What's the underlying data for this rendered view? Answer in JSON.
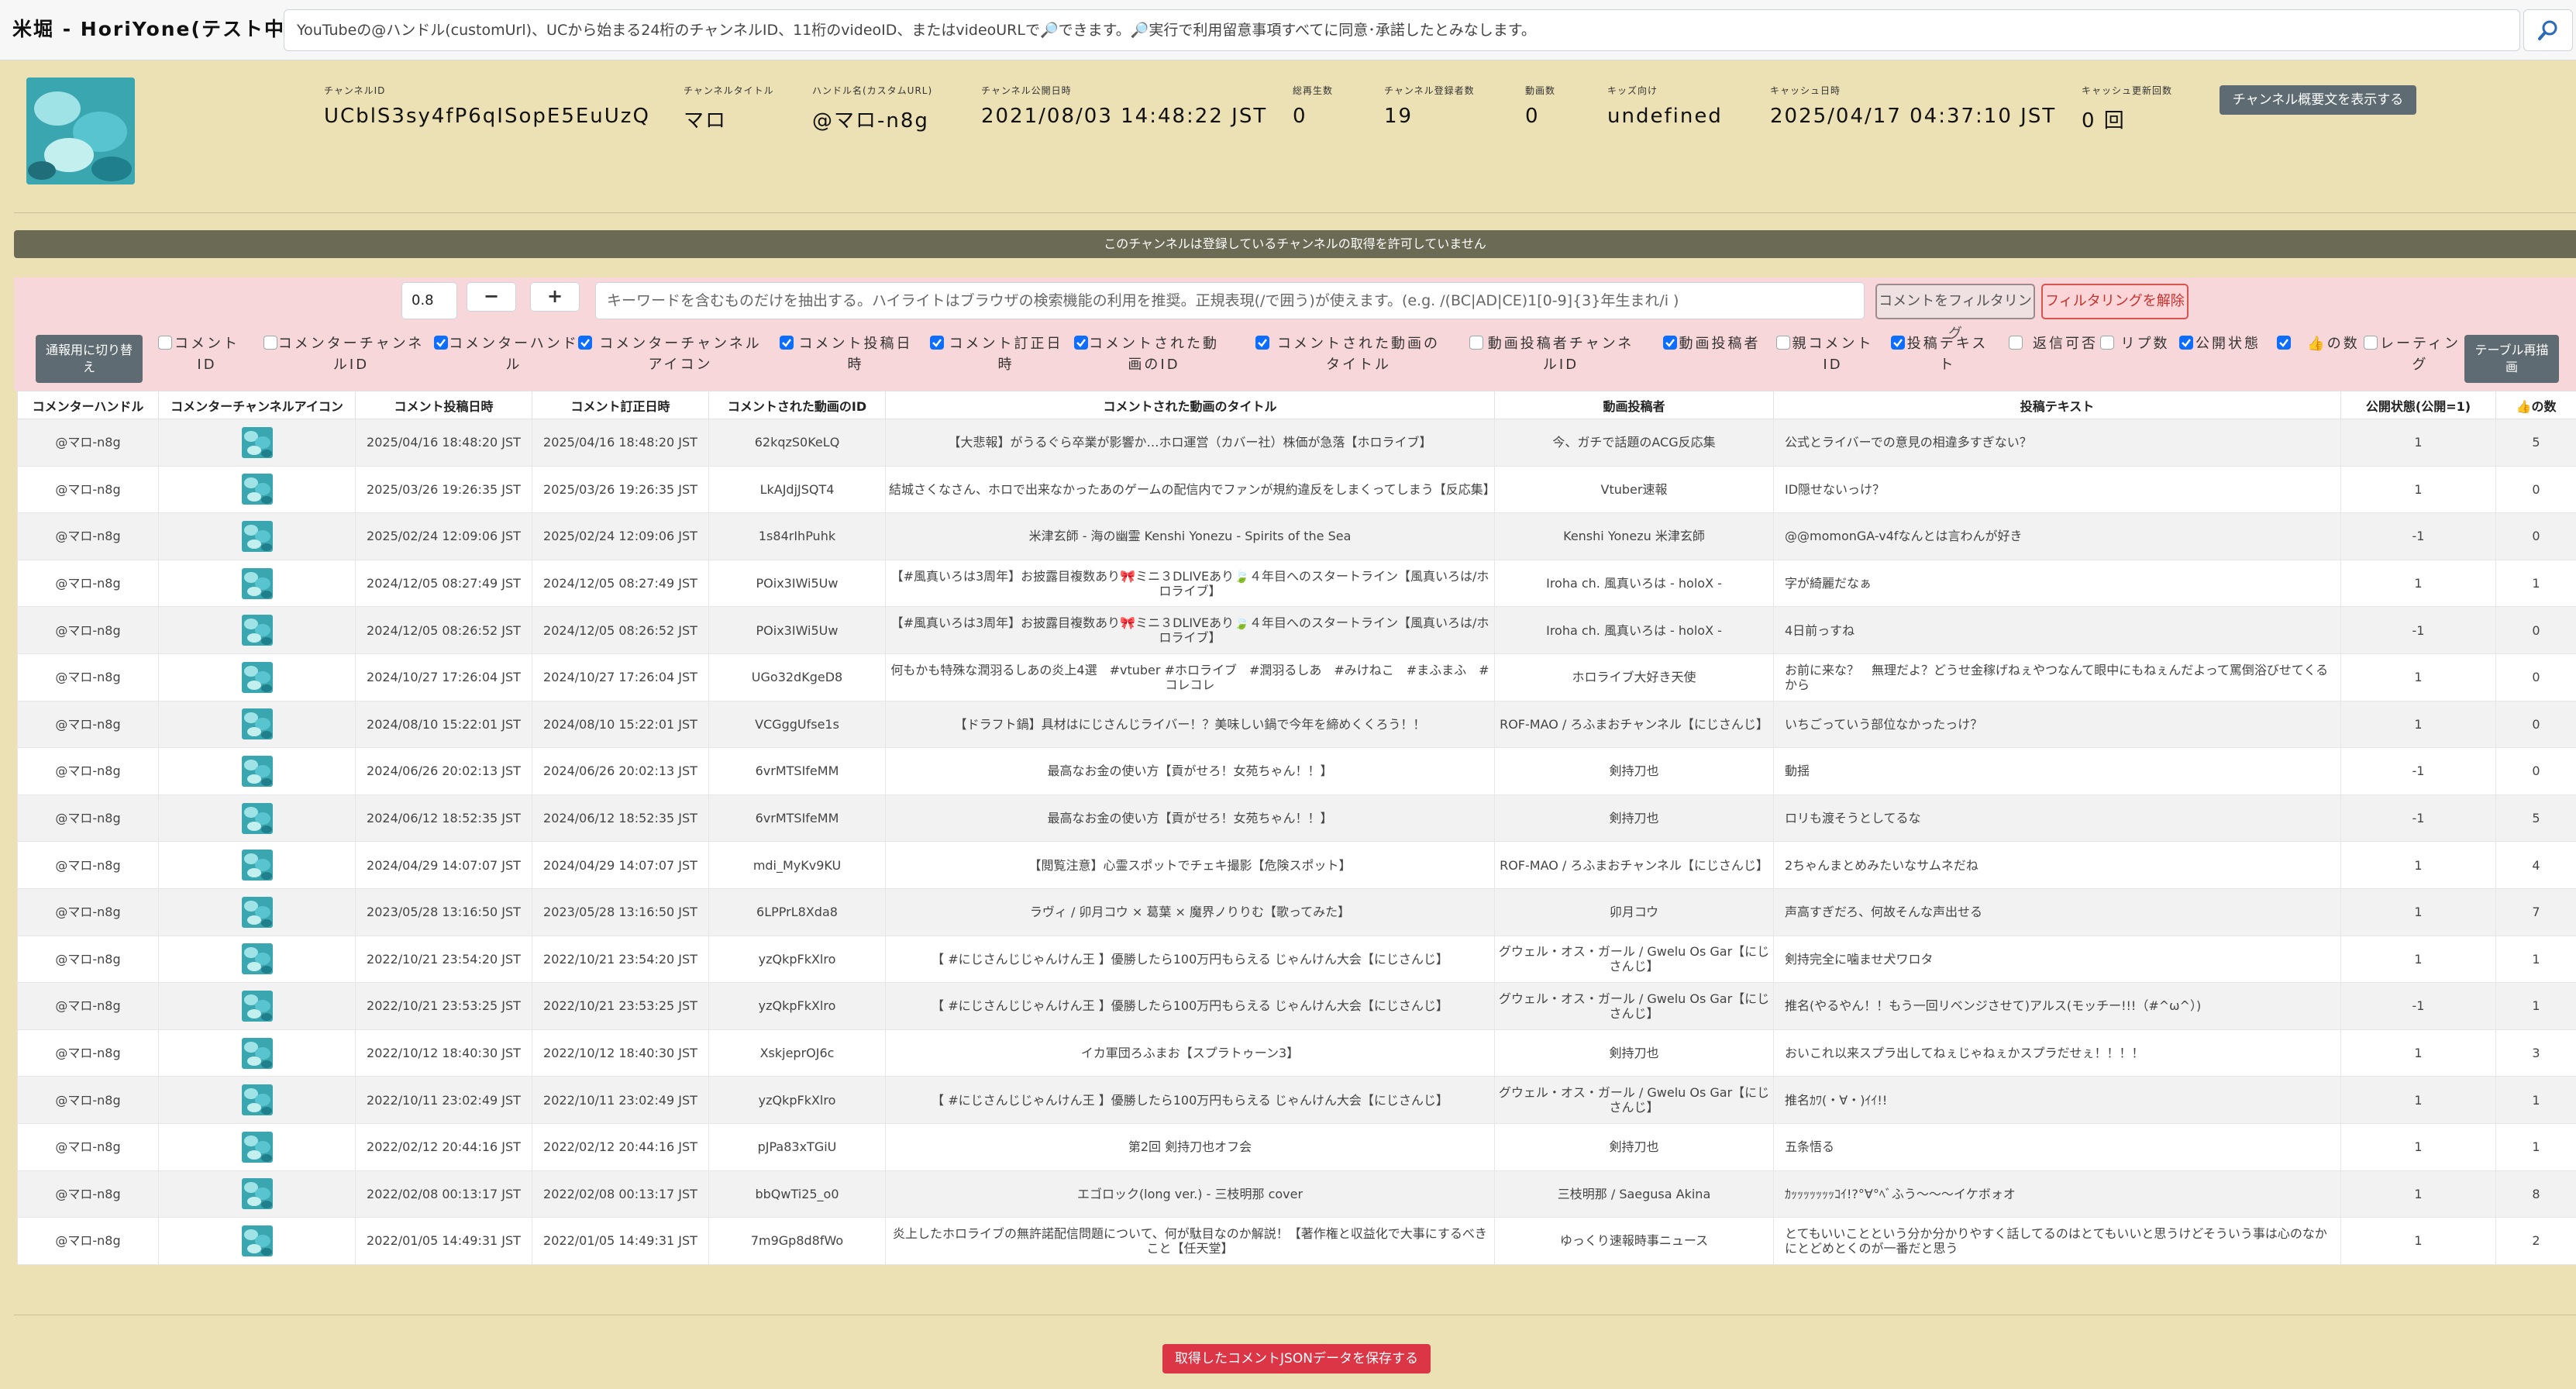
{
  "app": {
    "title": "米堀 - HoriYone(テスト中)"
  },
  "search": {
    "text": "YouTubeの@ハンドル(customUrl)、UCから始まる24桁のチャンネルID、11桁のvideoID、またはvideoURLで🔎できます。🔎実行で利用留意事項すべてに同意･承諾したとみなします。",
    "button_icon": "search-icon"
  },
  "channel": {
    "stats": [
      {
        "label": "チャンネルID",
        "value": "UCblS3sy4fP6qISopE5EuUzQ"
      },
      {
        "label": "チャンネルタイトル",
        "value": "マロ"
      },
      {
        "label": "ハンドル名(カスタムURL)",
        "value": "@マロ-n8g"
      },
      {
        "label": "チャンネル公開日時",
        "value": "2021/08/03 14:48:22 JST"
      },
      {
        "label": "総再生数",
        "value": "0"
      },
      {
        "label": "チャンネル登録者数",
        "value": "19"
      },
      {
        "label": "動画数",
        "value": "0"
      },
      {
        "label": "キッズ向け",
        "value": "undefined"
      },
      {
        "label": "キャッシュ日時",
        "value": "2025/04/17 04:37:10 JST"
      },
      {
        "label": "キャッシュ更新回数",
        "value": "0 回"
      }
    ],
    "show_desc_label": "チャンネル概要文を表示する"
  },
  "notice": "このチャンネルは登録しているチャンネルの取得を許可していません",
  "filter": {
    "zoom_value": "0.8",
    "minus_label": "−",
    "plus_label": "+",
    "keyword_placeholder": "キーワードを含むものだけを抽出する。ハイライトはブラウザの検索機能の利用を推奨。正規表現(/で囲う)が使えます。(e.g. /(BC|AD|CE)1[0-9]{3}年生まれ/i )",
    "filter_label": "コメントをフィルタリング",
    "unfilter_label": "フィルタリングを解除",
    "switch_label": "通報用に切り替え",
    "redraw_label": "テーブル再描画"
  },
  "columns_toggle": [
    {
      "label": "コメントID",
      "checked": false
    },
    {
      "label": "コメンターチャンネルID",
      "checked": false
    },
    {
      "label": "コメンターハンドル",
      "checked": true
    },
    {
      "label": "コメンターチャンネルアイコン",
      "checked": true
    },
    {
      "label": "コメント投稿日時",
      "checked": true
    },
    {
      "label": "コメント訂正日時",
      "checked": true
    },
    {
      "label": "コメントされた動画のID",
      "checked": true
    },
    {
      "label": "コメントされた動画のタイトル",
      "checked": true
    },
    {
      "label": "動画投稿者チャンネルID",
      "checked": false
    },
    {
      "label": "動画投稿者",
      "checked": true
    },
    {
      "label": "親コメントID",
      "checked": false
    },
    {
      "label": "投稿テキスト",
      "checked": true
    },
    {
      "label": "返信可否",
      "checked": false
    },
    {
      "label": "リプ数",
      "checked": false
    },
    {
      "label": "公開状態",
      "checked": true
    },
    {
      "label": "👍の数",
      "checked": true
    },
    {
      "label": "レーティング",
      "checked": false
    }
  ],
  "table": {
    "headers": [
      "コメンターハンドル",
      "コメンターチャンネルアイコン",
      "コメント投稿日時",
      "コメント訂正日時",
      "コメントされた動画のID",
      "コメントされた動画のタイトル",
      "動画投稿者",
      "投稿テキスト",
      "公開状態(公開=1)",
      "👍の数"
    ],
    "rows": [
      [
        "@マロ-n8g",
        "",
        "2025/04/16 18:48:20 JST",
        "2025/04/16 18:48:20 JST",
        "62kqzS0KeLQ",
        "【大悲報】がうるぐら卒業が影響か…ホロ運営（カバー社）株価が急落【ホロライブ】",
        "今、ガチで話題のACG反応集",
        "公式とライバーでの意見の相違多すぎない？",
        "1",
        "5"
      ],
      [
        "@マロ-n8g",
        "",
        "2025/03/26 19:26:35 JST",
        "2025/03/26 19:26:35 JST",
        "LkAJdjJSQT4",
        "結城さくなさん、ホロで出来なかったあのゲームの配信内でファンが規約違反をしまくってしまう【反応集】",
        "Vtuber速報",
        "ID隠せないっけ？",
        "1",
        "0"
      ],
      [
        "@マロ-n8g",
        "",
        "2025/02/24 12:09:06 JST",
        "2025/02/24 12:09:06 JST",
        "1s84rIhPuhk",
        "米津玄師 - 海の幽霊 Kenshi Yonezu - Spirits of the Sea",
        "Kenshi Yonezu 米津玄師",
        "@@momonGA-v4fなんとは言わんが好き",
        "-1",
        "0"
      ],
      [
        "@マロ-n8g",
        "",
        "2024/12/05 08:27:49 JST",
        "2024/12/05 08:27:49 JST",
        "POix3IWi5Uw",
        "【#風真いろは3周年】お披露目複数あり🎀ミニ３DLIVEあり🍃４年目へのスタートライン【風真いろは/ホロライブ】",
        "Iroha ch. 風真いろは - holoX -",
        "字が綺麗だなぁ",
        "1",
        "1"
      ],
      [
        "@マロ-n8g",
        "",
        "2024/12/05 08:26:52 JST",
        "2024/12/05 08:26:52 JST",
        "POix3IWi5Uw",
        "【#風真いろは3周年】お披露目複数あり🎀ミニ３DLIVEあり🍃４年目へのスタートライン【風真いろは/ホロライブ】",
        "Iroha ch. 風真いろは - holoX -",
        "4日前っすね",
        "-1",
        "0"
      ],
      [
        "@マロ-n8g",
        "",
        "2024/10/27 17:26:04 JST",
        "2024/10/27 17:26:04 JST",
        "UGo32dKgeD8",
        "何もかも特殊な潤羽るしあの炎上4選　#vtuber #ホロライブ　#潤羽るしあ　#みけねこ　#まふまふ　#コレコレ",
        "ホロライブ大好き天使",
        "お前に来な？　無理だよ？どうせ金稼げねぇやつなんて眼中にもねぇんだよって罵倒浴びせてくるから",
        "1",
        "0"
      ],
      [
        "@マロ-n8g",
        "",
        "2024/08/10 15:22:01 JST",
        "2024/08/10 15:22:01 JST",
        "VCGggUfse1s",
        "【ドラフト鍋】具材はにじさんじライバー！？美味しい鍋で今年を締めくくろう！！",
        "ROF-MAO / ろふまおチャンネル【にじさんじ】",
        "いちごっていう部位なかったっけ？",
        "1",
        "0"
      ],
      [
        "@マロ-n8g",
        "",
        "2024/06/26 20:02:13 JST",
        "2024/06/26 20:02:13 JST",
        "6vrMTSIfeMM",
        "最高なお金の使い方【貢がせろ！女苑ちゃん！！】",
        "剣持刀也",
        "動揺",
        "-1",
        "0"
      ],
      [
        "@マロ-n8g",
        "",
        "2024/06/12 18:52:35 JST",
        "2024/06/12 18:52:35 JST",
        "6vrMTSIfeMM",
        "最高なお金の使い方【貢がせろ！女苑ちゃん！！】",
        "剣持刀也",
        "ロリも渡そうとしてるな",
        "-1",
        "5"
      ],
      [
        "@マロ-n8g",
        "",
        "2024/04/29 14:07:07 JST",
        "2024/04/29 14:07:07 JST",
        "mdi_MyKv9KU",
        "【閲覧注意】心霊スポットでチェキ撮影【危険スポット】",
        "ROF-MAO / ろふまおチャンネル【にじさんじ】",
        "2ちゃんまとめみたいなサムネだね",
        "1",
        "4"
      ],
      [
        "@マロ-n8g",
        "",
        "2023/05/28 13:16:50 JST",
        "2023/05/28 13:16:50 JST",
        "6LPPrL8Xda8",
        "ラヴィ / 卯月コウ × 葛葉 × 魔界ノりりむ【歌ってみた】",
        "卯月コウ",
        "声高すぎだろ、何故そんな声出せる",
        "1",
        "7"
      ],
      [
        "@マロ-n8g",
        "",
        "2022/10/21 23:54:20 JST",
        "2022/10/21 23:54:20 JST",
        "yzQkpFkXlro",
        "【 #にじさんじじゃんけん王 】優勝したら100万円もらえる じゃんけん大会【にじさんじ】",
        "グウェル・オス・ガール / Gwelu Os Gar【にじさんじ】",
        "剣持完全に噛ませ犬ワロタ",
        "1",
        "1"
      ],
      [
        "@マロ-n8g",
        "",
        "2022/10/21 23:53:25 JST",
        "2022/10/21 23:53:25 JST",
        "yzQkpFkXlro",
        "【 #にじさんじじゃんけん王 】優勝したら100万円もらえる じゃんけん大会【にじさんじ】",
        "グウェル・オス・ガール / Gwelu Os Gar【にじさんじ】",
        "推名(やるやん！！もう一回リベンジさせて)アルス(モッチー!!!（#^ω^）)",
        "-1",
        "1"
      ],
      [
        "@マロ-n8g",
        "",
        "2022/10/12 18:40:30 JST",
        "2022/10/12 18:40:30 JST",
        "XskjeprOJ6c",
        "イカ軍団ろふまお【スプラトゥーン3】",
        "剣持刀也",
        "おいこれ以来スプラ出してねぇじゃねぇかスプラだせぇ！！！！",
        "1",
        "3"
      ],
      [
        "@マロ-n8g",
        "",
        "2022/10/11 23:02:49 JST",
        "2022/10/11 23:02:49 JST",
        "yzQkpFkXlro",
        "【 #にじさんじじゃんけん王 】優勝したら100万円もらえる じゃんけん大会【にじさんじ】",
        "グウェル・オス・ガール / Gwelu Os Gar【にじさんじ】",
        "推名ｶﾜ(・∀・)ｲｲ!!",
        "1",
        "1"
      ],
      [
        "@マロ-n8g",
        "",
        "2022/02/12 20:44:16 JST",
        "2022/02/12 20:44:16 JST",
        "pJPa83xTGiU",
        "第2回 剣持刀也オフ会",
        "剣持刀也",
        "五条悟る",
        "1",
        "1"
      ],
      [
        "@マロ-n8g",
        "",
        "2022/02/08 00:13:17 JST",
        "2022/02/08 00:13:17 JST",
        "bbQwTi25_o0",
        "エゴロック(long ver.) - 三枝明那 cover",
        "三枝明那 / Saegusa Akina",
        "ｶｯｯｯｯｯｯｯｺｲ!?°∀°ﾍﾞふう〜〜〜イケボォオ",
        "1",
        "8"
      ],
      [
        "@マロ-n8g",
        "",
        "2022/01/05 14:49:31 JST",
        "2022/01/05 14:49:31 JST",
        "7m9Gp8d8fWo",
        "炎上したホロライブの無許諾配信問題について、何が駄目なのか解説！【著作権と収益化で大事にするべきこと【任天堂】",
        "ゆっくり速報時事ニュース",
        "とてもいいことという分か分かりやすく話してるのはとてもいいと思うけどそういう事は心のなかにとどめとくのが一番だと思う",
        "1",
        "2"
      ]
    ]
  },
  "save_label": "取得したコメントJSONデータを保存する"
}
